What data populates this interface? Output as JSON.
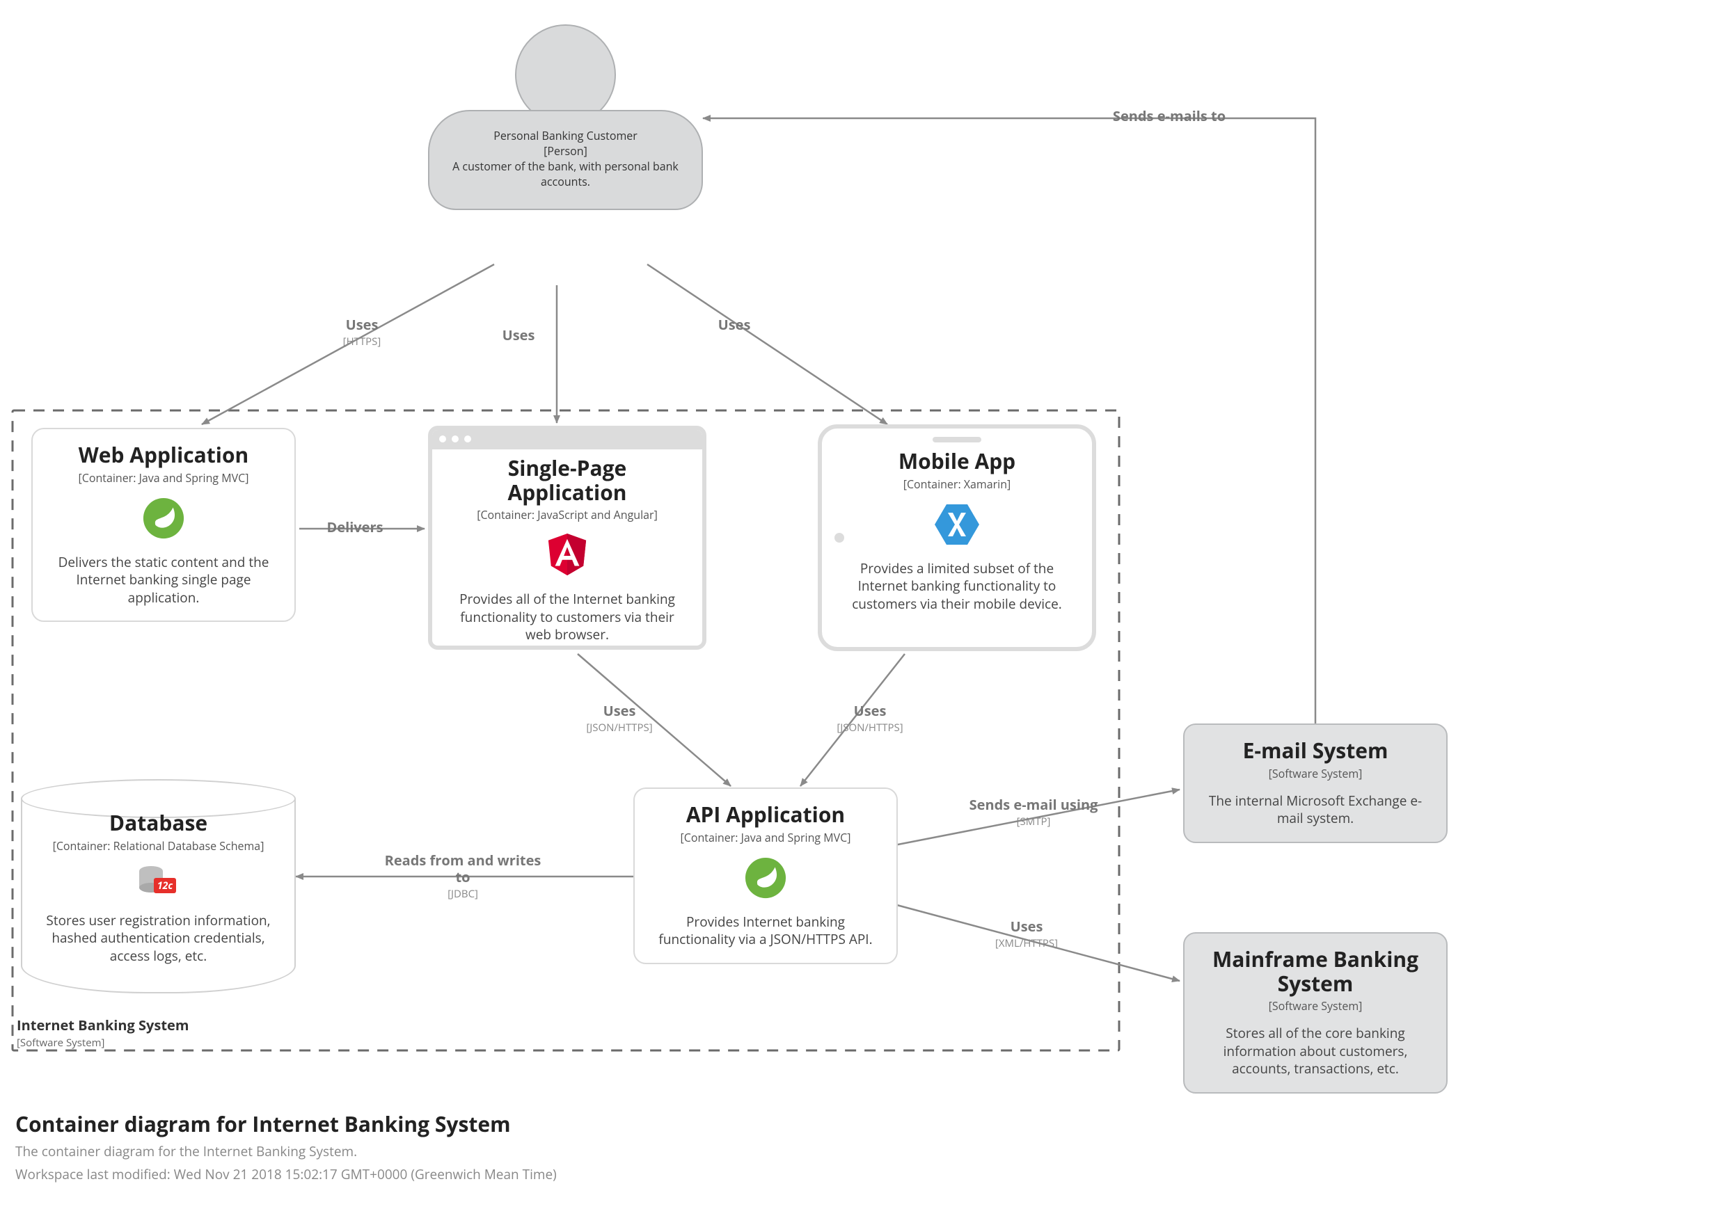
{
  "diagram": {
    "title": "Container diagram for Internet Banking System",
    "subtitle": "The container diagram for the Internet Banking System.",
    "modified": "Workspace last modified: Wed Nov 21 2018 15:02:17 GMT+0000 (Greenwich Mean Time)"
  },
  "boundary": {
    "name": "Internet Banking System",
    "stereo": "[Software System]"
  },
  "nodes": {
    "person": {
      "title": "Personal Banking Customer",
      "stereo": "[Person]",
      "desc": "A customer of the bank, with personal bank accounts."
    },
    "web": {
      "title": "Web Application",
      "stereo": "[Container: Java and Spring MVC]",
      "desc": "Delivers the static content and the Internet banking single page application.",
      "icon": "spring"
    },
    "spa": {
      "title": "Single-Page Application",
      "stereo": "[Container: JavaScript and Angular]",
      "desc": "Provides all of the Internet banking functionality to customers via their web browser.",
      "icon": "angular"
    },
    "mobile": {
      "title": "Mobile App",
      "stereo": "[Container: Xamarin]",
      "desc": "Provides a limited subset of the Internet banking functionality to customers via their mobile device.",
      "icon": "xamarin"
    },
    "api": {
      "title": "API Application",
      "stereo": "[Container: Java and Spring MVC]",
      "desc": "Provides Internet banking functionality via a JSON/HTTPS API.",
      "icon": "spring"
    },
    "db": {
      "title": "Database",
      "stereo": "[Container: Relational Database Schema]",
      "desc": "Stores user registration information, hashed authentication credentials, access logs, etc.",
      "icon": "oracle"
    },
    "email": {
      "title": "E-mail System",
      "stereo": "[Software System]",
      "desc": "The internal Microsoft Exchange e-mail system."
    },
    "mainframe": {
      "title": "Mainframe Banking System",
      "stereo": "[Software System]",
      "desc": "Stores all of the core banking information about customers, accounts, transactions, etc."
    }
  },
  "edges": {
    "uses_web": {
      "label": "Uses",
      "tech": "[HTTPS]"
    },
    "uses_spa": {
      "label": "Uses"
    },
    "uses_mobile": {
      "label": "Uses"
    },
    "delivers": {
      "label": "Delivers"
    },
    "spa_api": {
      "label": "Uses",
      "tech": "[JSON/HTTPS]"
    },
    "mobile_api": {
      "label": "Uses",
      "tech": "[JSON/HTTPS]"
    },
    "api_db": {
      "label": "Reads from and writes to",
      "tech": "[JDBC]"
    },
    "api_email": {
      "label": "Sends e-mail using",
      "tech": "[SMTP]"
    },
    "api_mainframe": {
      "label": "Uses",
      "tech": "[XML/HTTPS]"
    },
    "email_person": {
      "label": "Sends e-mails to"
    }
  },
  "icons": {
    "spring": "spring-icon",
    "angular": "angular-icon",
    "xamarin": "xamarin-icon",
    "oracle": "oracle-icon"
  }
}
